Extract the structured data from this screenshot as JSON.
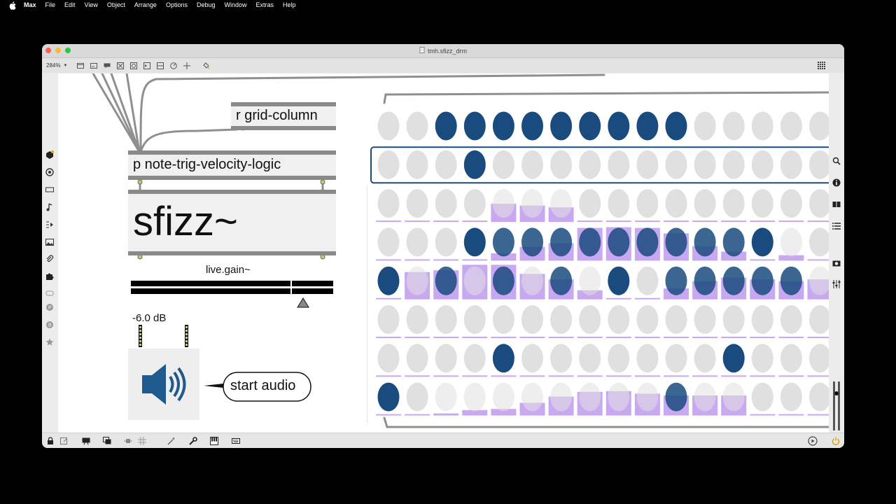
{
  "menubar": {
    "app": "Max",
    "items": [
      "File",
      "Edit",
      "View",
      "Object",
      "Arrange",
      "Options",
      "Debug",
      "Window",
      "Extras",
      "Help"
    ]
  },
  "window": {
    "title": "tmh.sfizz_drm",
    "zoom": "284%"
  },
  "patch": {
    "receive_object": "r grid-column",
    "subpatch_object": "p note-trig-velocity-logic",
    "sfizz_object": "sfizz~",
    "gain_label": "live.gain~",
    "gain_value": "-6.0 dB",
    "gain_level": 0.85,
    "comment": "start audio"
  },
  "sequencer": {
    "columns": 16,
    "on_color": "#1a4b7f",
    "off_color": "#e0e0e0",
    "velocity_color": "#c9a8f2",
    "rows": [
      {
        "on": [
          2,
          3,
          4,
          5,
          6,
          7,
          8,
          9,
          10
        ],
        "velocity": [
          0,
          0,
          0,
          0,
          0,
          0,
          0,
          0,
          0,
          0,
          0,
          0,
          0,
          0,
          0,
          0
        ]
      },
      {
        "on": [
          3
        ],
        "velocity": [
          0,
          0,
          0,
          0,
          0,
          0,
          0,
          0,
          0,
          0,
          0,
          0,
          0,
          0,
          0,
          0
        ],
        "selected": true
      },
      {
        "on": [],
        "velocity": [
          0,
          0,
          0,
          0,
          0.5,
          0.45,
          0.4,
          0,
          0,
          0,
          0,
          0,
          0,
          0,
          0,
          0
        ]
      },
      {
        "on": [
          3,
          4,
          5,
          6,
          7,
          8,
          9,
          10,
          11,
          12,
          13
        ],
        "velocity": [
          0,
          0,
          0,
          0,
          0.2,
          0.38,
          0.48,
          0.9,
          0.92,
          0.9,
          0.75,
          0.4,
          0.25,
          0,
          0.15,
          0
        ]
      },
      {
        "on": [
          0,
          2,
          4,
          6,
          8,
          10,
          11,
          12,
          13,
          14
        ],
        "velocity": [
          0,
          0.75,
          0.8,
          0.95,
          0.95,
          0.7,
          0.55,
          0.25,
          0,
          0,
          0.3,
          0.5,
          0.6,
          0.55,
          0.5,
          0.55
        ]
      },
      {
        "on": [],
        "velocity": [
          0,
          0,
          0,
          0,
          0,
          0,
          0,
          0,
          0,
          0,
          0,
          0,
          0,
          0,
          0,
          0
        ]
      },
      {
        "on": [
          4,
          12
        ],
        "velocity": [
          0,
          0,
          0,
          0,
          0,
          0,
          0,
          0,
          0,
          0,
          0,
          0,
          0,
          0,
          0,
          0
        ]
      },
      {
        "on": [
          0,
          10
        ],
        "velocity": [
          0,
          0,
          0.05,
          0.15,
          0.18,
          0.35,
          0.52,
          0.65,
          0.67,
          0.6,
          0.55,
          0.55,
          0.55,
          0,
          0,
          0
        ]
      }
    ]
  },
  "icons": {
    "left_sidebar": [
      "package-manager-icon",
      "target-icon",
      "presentation-icon",
      "music-note-icon",
      "sequence-icon",
      "image-icon",
      "paperclip-icon",
      "puzzle-icon",
      "loop-icon",
      "p-badge-icon",
      "b-badge-icon",
      "star-icon"
    ],
    "right_sidebar": [
      "search-icon",
      "info-icon",
      "split-view-icon",
      "list-icon",
      "snapshot-icon",
      "mixer-icon"
    ],
    "bottom_bar": [
      "lock-icon",
      "edit-mode-icon",
      "presentation-toggle-icon",
      "new-view-icon",
      "debug-icon",
      "grid-icon",
      "wand-icon",
      "wrench-icon",
      "piano-icon",
      "keyboard-icon",
      "playback-icon",
      "power-icon"
    ]
  }
}
